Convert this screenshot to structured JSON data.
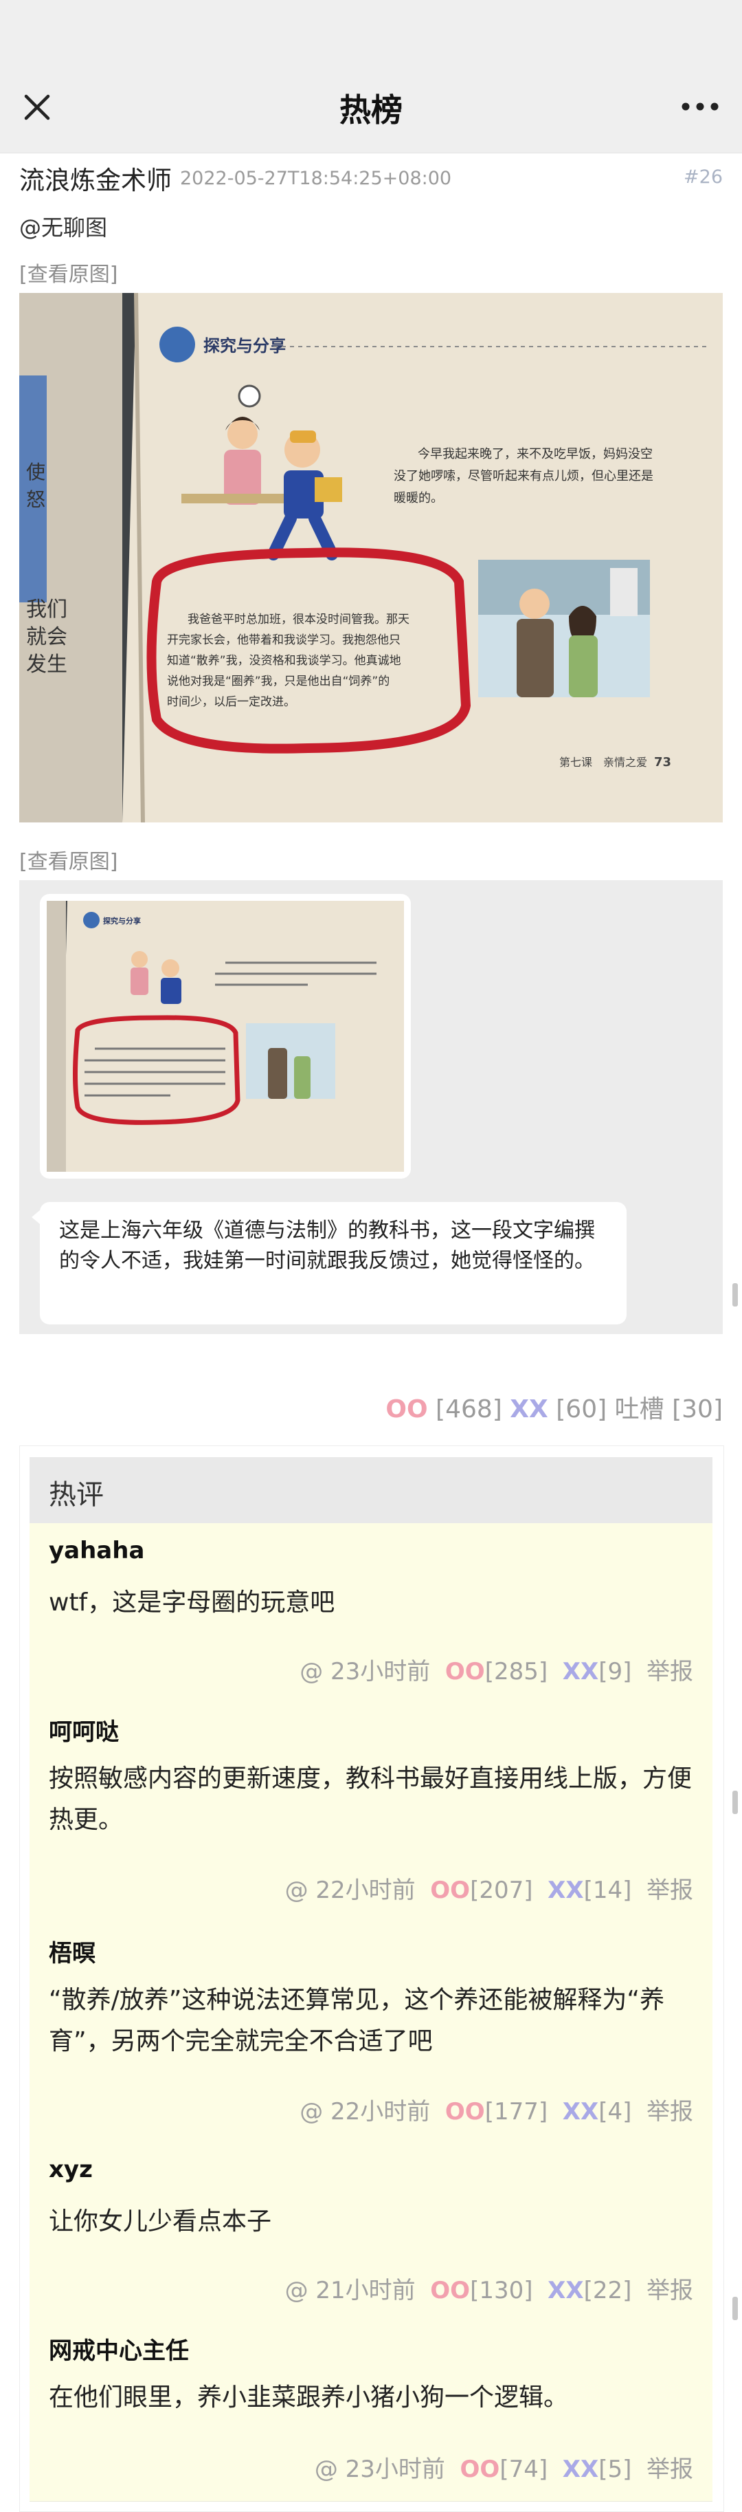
{
  "nav": {
    "title": "热榜"
  },
  "post": {
    "author": "流浪炼金术师",
    "timestamp": "2022-05-27T18:54:25+08:00",
    "id": "#26",
    "mention": "@无聊图",
    "view_original": "[查看原图]",
    "book": {
      "section": "探究与分享",
      "para1": "今早我起来晚了，来不及吃早饭，妈妈没空",
      "para1b": "没了她啰嗦，尽管听起来有点儿烦，但心里还是",
      "para1c": "暖暖的。",
      "circled": [
        "我爸爸平时总加班，很本没时间管我。那天",
        "开完家长会，他带着和我谈学习。我抱怨他只",
        "知道“散养”我，没资格和我谈学习。他真诚地",
        "说他对我是“圈养”我，只是他出自“饲养”的",
        "时间少，以后一定改进。"
      ],
      "footer": "第七课　亲情之爱",
      "page": "73"
    },
    "wechat_caption": "这是上海六年级《道德与法制》的教科书，这一段文字编撰的令人不适，我娃第一时间就跟我反馈过，她觉得怪怪的。"
  },
  "votes": {
    "oo_label": "OO",
    "oo": "[468]",
    "xx_label": "XX",
    "xx": "[60]",
    "tucao_label": "吐槽",
    "tucao": "[30]"
  },
  "hot": {
    "title": "热评",
    "report_label": "举报",
    "comments": [
      {
        "author": "yahaha",
        "text": "wtf，这是字母圈的玩意吧",
        "time": "@ 23小时前",
        "oo": "[285]",
        "xx": "[9]"
      },
      {
        "author": "呵呵哒",
        "text": "按照敏感内容的更新速度，教科书最好直接用线上版，方便热更。",
        "time": "@ 22小时前",
        "oo": "[207]",
        "xx": "[14]"
      },
      {
        "author": "梧暝",
        "text": "“散养/放养”这种说法还算常见，这个养还能被解释为“养育”，另两个完全就完全不合适了吧",
        "time": "@ 22小时前",
        "oo": "[177]",
        "xx": "[4]"
      },
      {
        "author": "xyz",
        "text": "让你女儿少看点本子",
        "time": "@ 21小时前",
        "oo": "[130]",
        "xx": "[22]"
      },
      {
        "author": "网戒中心主任",
        "text": "在他们眼里，养小韭菜跟养小猪小狗一个逻辑。",
        "time": "@ 23小时前",
        "oo": "[74]",
        "xx": "[5]"
      }
    ]
  },
  "colors": {
    "oo": "#f2a0ae",
    "xx": "#a9a9e6",
    "comment_bg": "#fdfde5",
    "circle": "#c81e2c"
  }
}
